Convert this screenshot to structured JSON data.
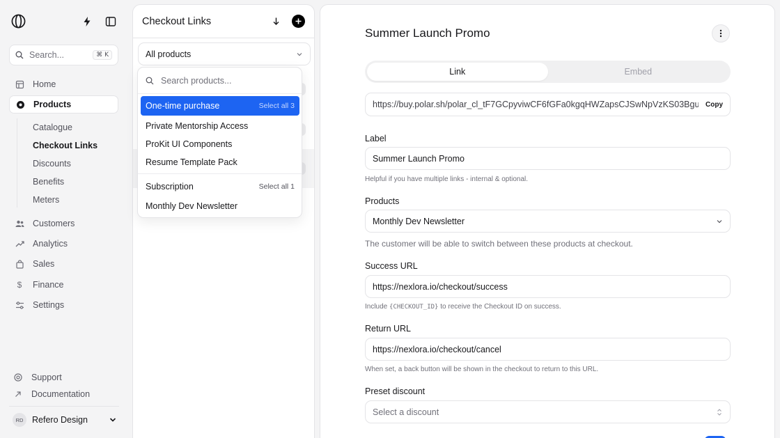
{
  "sidebar": {
    "search": {
      "placeholder": "Search...",
      "shortcut": "⌘ K"
    },
    "nav": [
      {
        "label": "Home",
        "icon": "home-icon"
      },
      {
        "label": "Products",
        "icon": "products-icon",
        "active": true
      },
      {
        "label": "Customers",
        "icon": "customers-icon"
      },
      {
        "label": "Analytics",
        "icon": "analytics-icon"
      },
      {
        "label": "Sales",
        "icon": "sales-icon"
      },
      {
        "label": "Finance",
        "icon": "dollar-icon"
      },
      {
        "label": "Settings",
        "icon": "settings-icon"
      }
    ],
    "subnav": [
      {
        "label": "Catalogue"
      },
      {
        "label": "Checkout Links",
        "active": true
      },
      {
        "label": "Discounts"
      },
      {
        "label": "Benefits"
      },
      {
        "label": "Meters"
      }
    ],
    "footer": [
      {
        "label": "Support",
        "icon": "support-icon"
      },
      {
        "label": "Documentation",
        "icon": "external-link-icon"
      }
    ],
    "user": {
      "initials": "RD",
      "name": "Refero Design"
    }
  },
  "list": {
    "title": "Checkout Links",
    "filter": "All products"
  },
  "dropdown": {
    "search_placeholder": "Search products...",
    "groups": [
      {
        "label": "One-time purchase",
        "select_all": "Select all 3",
        "items": [
          "Private Mentorship Access",
          "ProKit UI Components",
          "Resume Template Pack"
        ]
      },
      {
        "label": "Subscription",
        "select_all": "Select all 1",
        "items": [
          "Monthly Dev Newsletter"
        ]
      }
    ]
  },
  "detail": {
    "title": "Summer Launch Promo",
    "tabs": [
      "Link",
      "Embed"
    ],
    "url": "https://buy.polar.sh/polar_cl_tF7GCpyviwCF6fGFa0kgqHWZapsCJSwNpVzKS03Bgu",
    "copy_label": "Copy",
    "label_field": {
      "label": "Label",
      "value": "Summer Launch Promo",
      "help": "Helpful if you have multiple links - internal & optional."
    },
    "products_field": {
      "label": "Products",
      "value": "Monthly Dev Newsletter",
      "help": "The customer will be able to switch between these products at checkout."
    },
    "success_field": {
      "label": "Success URL",
      "value": "https://nexlora.io/checkout/success",
      "help_pre": "Include",
      "help_code": "{CHECKOUT_ID}",
      "help_post": "to receive the Checkout ID on success."
    },
    "return_field": {
      "label": "Return URL",
      "value": "https://nexlora.io/checkout/cancel",
      "help": "When set, a back button will be shown in the checkout to return to this URL."
    },
    "discount_field": {
      "label": "Preset discount",
      "placeholder": "Select a discount"
    }
  },
  "colors": {
    "accent": "#1d64f2",
    "bg": "#f4f4f5",
    "border": "#e4e4e7"
  }
}
